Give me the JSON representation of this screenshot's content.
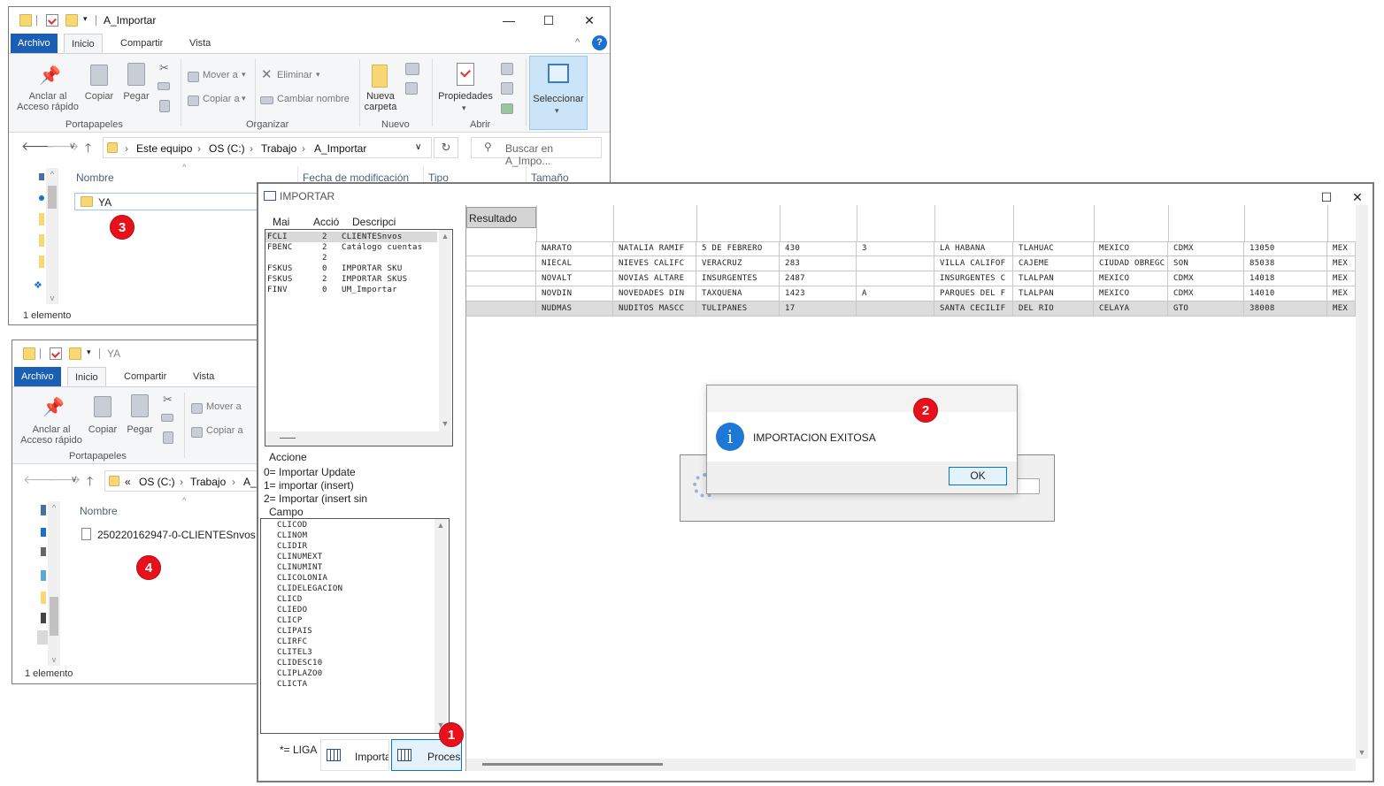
{
  "explorer1": {
    "title": "A_Importar",
    "tabs": [
      "Archivo",
      "Inicio",
      "Compartir",
      "Vista"
    ],
    "ribbon": {
      "pin": [
        "Anclar al",
        "Acceso rápido"
      ],
      "copy": "Copiar",
      "paste": "Pegar",
      "group_clipboard": "Portapapeles",
      "move_to": "Mover a",
      "copy_to": "Copiar a",
      "delete": "Eliminar",
      "rename": "Cambiar nombre",
      "group_organize": "Organizar",
      "new_folder": [
        "Nueva",
        "carpeta"
      ],
      "group_new": "Nuevo",
      "properties": "Propiedades",
      "group_open": "Abrir",
      "select": "Seleccionar"
    },
    "breadcrumb": [
      "Este equipo",
      "OS (C:)",
      "Trabajo",
      "A_Importar"
    ],
    "search_placeholder": "Buscar en A_Impo...",
    "columns": [
      "Nombre",
      "Fecha de modificación",
      "Tipo",
      "Tamaño"
    ],
    "items": [
      "YA"
    ],
    "status": "1 elemento",
    "badge": "3"
  },
  "explorer2": {
    "title": "YA",
    "tabs": [
      "Archivo",
      "Inicio",
      "Compartir",
      "Vista"
    ],
    "ribbon": {
      "pin": [
        "Anclar al",
        "Acceso rápido"
      ],
      "copy": "Copiar",
      "paste": "Pegar",
      "group_clipboard": "Portapapeles",
      "move_to": "Mover a",
      "copy_to": "Copiar a"
    },
    "breadcrumb": [
      "«",
      "OS (C:)",
      "Trabajo",
      "A_I"
    ],
    "columns": [
      "Nombre"
    ],
    "items": [
      "250220162947-0-CLIENTESnvos"
    ],
    "status": "1 elemento",
    "badge": "4"
  },
  "importar": {
    "title": "IMPORTAR",
    "list_headers": [
      "Mai",
      "Acció",
      "Descripci"
    ],
    "list_rows": [
      [
        "FCLI",
        "2",
        "CLIENTESnvos"
      ],
      [
        "FBENC",
        "2",
        "Catálogo cuentas"
      ],
      [
        "",
        "2",
        ""
      ],
      [
        "FSKUS",
        "0",
        "IMPORTAR SKU"
      ],
      [
        "FSKUS",
        "2",
        "IMPORTAR SKUS"
      ],
      [
        "FINV",
        "0",
        "UM_Importar"
      ]
    ],
    "acciones_title": "Accione",
    "acciones": [
      "0= Importar Update",
      "1= importar (insert)",
      "2= Importar (insert sin"
    ],
    "campo_title": "Campo",
    "campos": [
      "CLICOD",
      "CLINOM",
      "CLIDIR",
      "CLINUMEXT",
      "CLINUMINT",
      "CLICOLONIA",
      "CLIDELEGACION",
      "CLICD",
      "CLIEDO",
      "CLICP",
      "CLIPAIS",
      "CLIRFC",
      "CLITEL3",
      "CLIDESC10",
      "CLIPLAZO0",
      "CLICTA"
    ],
    "liga": "*= LIGA",
    "btn_import": "Importa",
    "btn_process": "Procesa",
    "grid_header": "Resultado",
    "grid_rows": [
      [
        "NARATO",
        "NATALIA RAMIF",
        "5 DE FEBRERO",
        "430",
        "3",
        "LA HABANA",
        "TLAHUAC",
        "MEXICO",
        "CDMX",
        "13050",
        "MEX"
      ],
      [
        "NIECAL",
        "NIEVES CALIFC",
        "VERACRUZ",
        "283",
        "",
        "VILLA CALIFOF",
        "CAJEME",
        "CIUDAD OBREGC",
        "SON",
        "85038",
        "MEX"
      ],
      [
        "NOVALT",
        "NOVIAS ALTARE",
        "INSURGENTES",
        "2487",
        "",
        "INSURGENTES C",
        "TLALPAN",
        "MEXICO",
        "CDMX",
        "14018",
        "MEX"
      ],
      [
        "NOVDIN",
        "NOVEDADES DIN",
        "TAXQUENA",
        "1423",
        "A",
        "PARQUES DEL F",
        "TLALPAN",
        "MEXICO",
        "CDMX",
        "14010",
        "MEX"
      ],
      [
        "NUDMAS",
        "NUDITOS MASCC",
        "TULIPANES",
        "17",
        "",
        "SANTA CECILIF",
        "DEL RIO",
        "CELAYA",
        "GTO",
        "38008",
        "MEX"
      ]
    ],
    "badge": "1"
  },
  "dialog": {
    "message": "IMPORTACION EXITOSA",
    "ok": "OK",
    "badge": "2"
  },
  "colors": {
    "badge": "#e8111b",
    "file_tab": "#1a5fb4",
    "info": "#1e78d6"
  }
}
